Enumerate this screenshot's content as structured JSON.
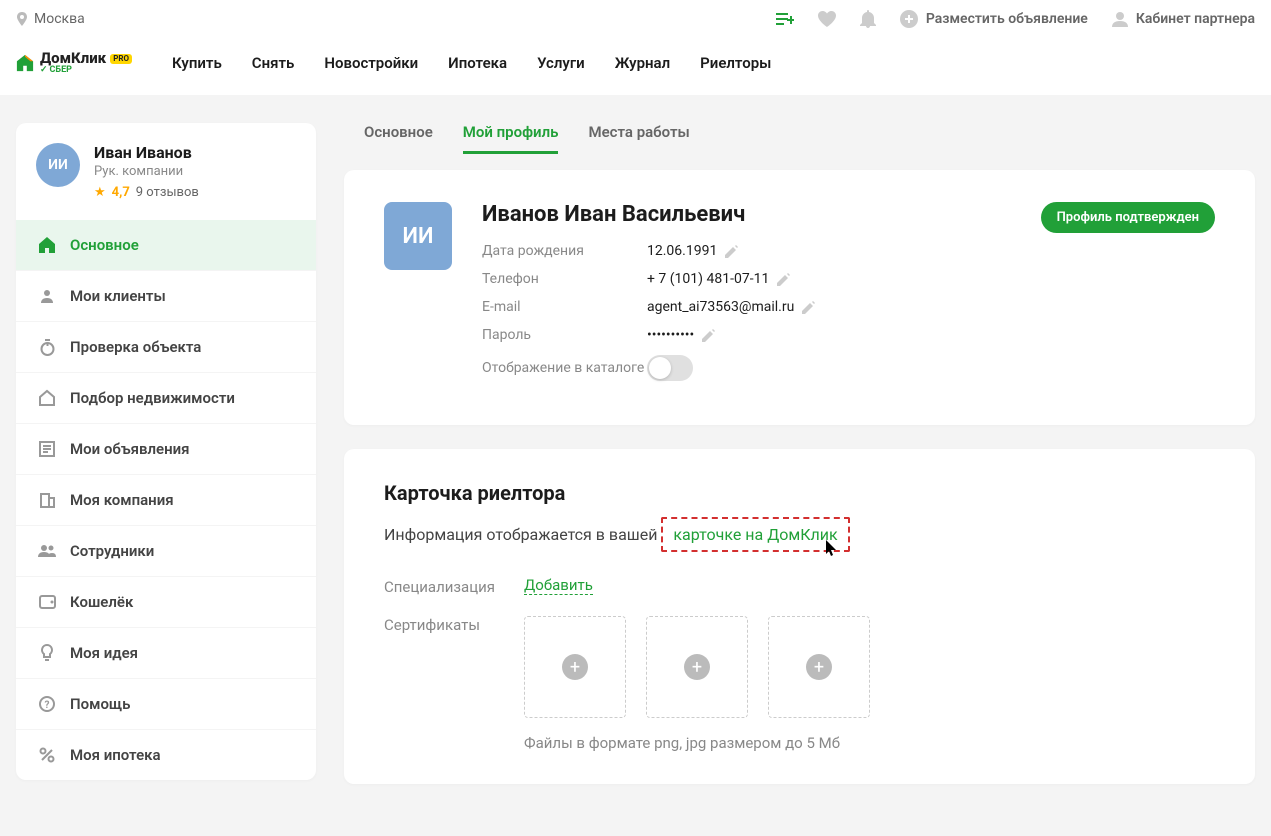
{
  "topbar": {
    "city": "Москва",
    "post_ad": "Разместить объявление",
    "partner_cabinet": "Кабинет партнера"
  },
  "logo": {
    "name": "ДомКлик",
    "pro": "PRO",
    "sber": "СБЕР"
  },
  "nav": [
    "Купить",
    "Снять",
    "Новостройки",
    "Ипотека",
    "Услуги",
    "Журнал",
    "Риелторы"
  ],
  "sidebar": {
    "user": {
      "initials": "ИИ",
      "name": "Иван Иванов",
      "role": "Рук. компании",
      "rating": "4,7",
      "reviews": "9 отзывов"
    },
    "items": [
      "Основное",
      "Мои клиенты",
      "Проверка объекта",
      "Подбор недвижимости",
      "Мои объявления",
      "Моя компания",
      "Сотрудники",
      "Кошелёк",
      "Моя идея",
      "Помощь",
      "Моя ипотека"
    ]
  },
  "tabs": [
    "Основное",
    "Мой профиль",
    "Места работы"
  ],
  "profile": {
    "initials": "ИИ",
    "fullname": "Иванов Иван Васильевич",
    "badge": "Профиль подтвержден",
    "fields": {
      "dob_label": "Дата рождения",
      "dob": "12.06.1991",
      "phone_label": "Телефон",
      "phone": "+ 7 (101) 481-07-11",
      "email_label": "E-mail",
      "email": "agent_ai73563@mail.ru",
      "password_label": "Пароль",
      "password": "••••••••••",
      "catalog_label": "Отображение в каталоге"
    }
  },
  "realtor_card": {
    "title": "Карточка риелтора",
    "desc_prefix": "Информация отображается в вашей",
    "desc_link": "карточке на ДомКлик",
    "spec_label": "Специализация",
    "spec_add": "Добавить",
    "cert_label": "Сертификаты",
    "cert_hint": "Файлы в формате png, jpg размером до 5 Мб"
  }
}
